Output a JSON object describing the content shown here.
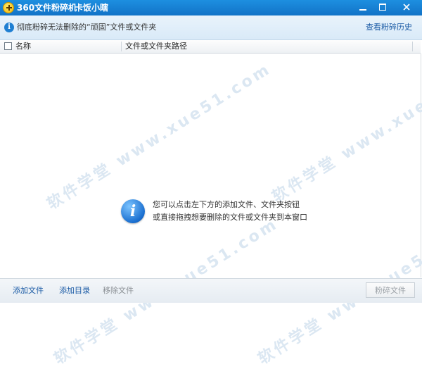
{
  "window": {
    "title": "360文件粉碎机",
    "user_label": "卡饭小瞎",
    "controls": [
      "minimize",
      "maximize",
      "close"
    ]
  },
  "info_bar": {
    "icon": "info-icon",
    "text": "彻底粉碎无法删除的“顽固”文件或文件夹",
    "history_link": "查看粉碎历史"
  },
  "table": {
    "columns": [
      "名称",
      "文件或文件夹路径"
    ],
    "rows": []
  },
  "empty_hint": {
    "icon": "info-icon",
    "line1": "您可以点击左下方的添加文件、文件夹按钮",
    "line2": "或直接拖拽想要删除的文件或文件夹到本窗口"
  },
  "watermark": "软件学堂 www.xue51.com",
  "toolbar": {
    "add_file": "添加文件",
    "add_dir": "添加目录",
    "remove_file": "移除文件",
    "shred": "粉碎文件"
  },
  "colors": {
    "titlebar": "#1273c7",
    "link": "#1a5aa5",
    "disabled": "#9aa0a6"
  }
}
